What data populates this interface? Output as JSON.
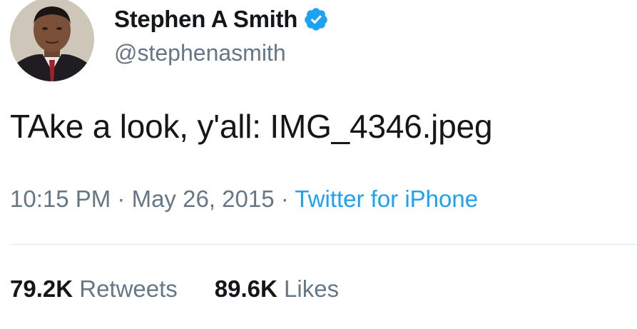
{
  "author": {
    "display_name": "Stephen A Smith",
    "handle": "@stephenasmith",
    "verified": true,
    "avatar_icon": "profile-photo",
    "verified_icon": "verified-badge-icon"
  },
  "tweet": {
    "text": "TAke a look, y'all: IMG_4346.jpeg",
    "time": "10:15 PM",
    "separator": "·",
    "date": "May 26, 2015",
    "source": "Twitter for iPhone"
  },
  "stats": {
    "retweets_count": "79.2K",
    "retweets_label": "Retweets",
    "likes_count": "89.6K",
    "likes_label": "Likes"
  },
  "colors": {
    "link": "#1da1f2",
    "secondary_text": "#657786",
    "primary_text": "#14171a",
    "divider": "#e1e8ed"
  }
}
